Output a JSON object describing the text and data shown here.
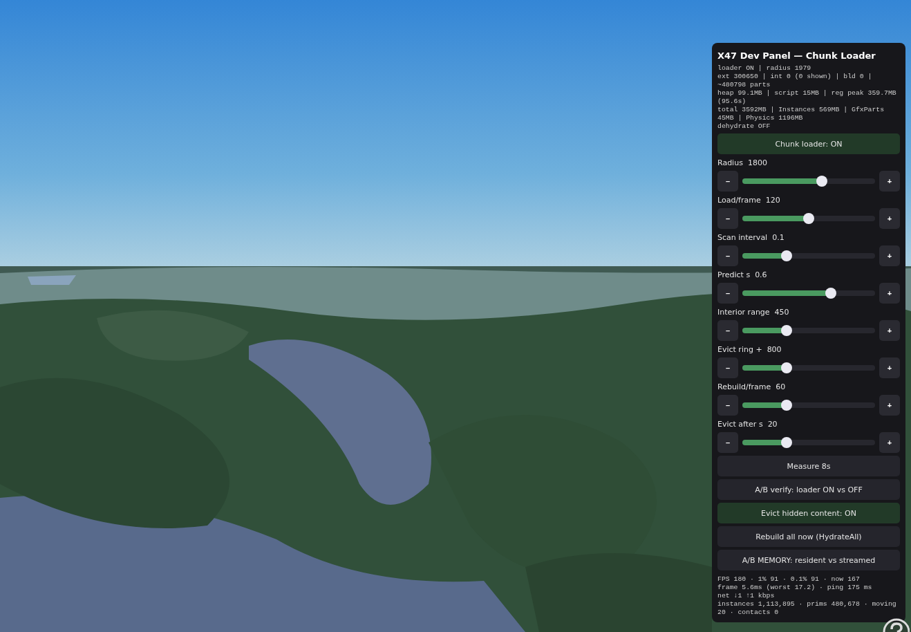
{
  "panel": {
    "title": "X47 Dev Panel — Chunk Loader",
    "status_lines": [
      "loader ON | radius 1979",
      "ext 300650 | int 0 (0 shown) | bld 0 | ~480798 parts",
      "heap 99.1MB | script 15MB | reg peak 359.7MB (95.6s)",
      "total 3592MB | Instances 569MB | GfxParts 45MB | Physics 1196MB",
      "dehydrate OFF"
    ],
    "controls": [
      {
        "kind": "toggle",
        "label": "Chunk loader: ON",
        "on": true
      },
      {
        "kind": "slider",
        "label": "Radius",
        "value": "1800",
        "level": 0.6,
        "minus": "–",
        "plus": "+"
      },
      {
        "kind": "slider",
        "label": "Load/frame",
        "value": "120",
        "level": 0.5,
        "minus": "–",
        "plus": "+"
      },
      {
        "kind": "slider",
        "label": "Scan interval",
        "value": "0.1",
        "level": 0.333,
        "minus": "–",
        "plus": "+"
      },
      {
        "kind": "slider",
        "label": "Predict s",
        "value": "0.6",
        "level": 0.667,
        "minus": "–",
        "plus": "+"
      },
      {
        "kind": "slider",
        "label": "Interior range",
        "value": "450",
        "level": 0.333,
        "minus": "–",
        "plus": "+"
      },
      {
        "kind": "slider",
        "label": "Evict ring +",
        "value": "800",
        "level": 0.333,
        "minus": "–",
        "plus": "+"
      },
      {
        "kind": "slider",
        "label": "Rebuild/frame",
        "value": "60",
        "level": 0.333,
        "minus": "–",
        "plus": "+"
      },
      {
        "kind": "slider",
        "label": "Evict after s",
        "value": "20",
        "level": 0.333,
        "minus": "–",
        "plus": "+"
      },
      {
        "kind": "action",
        "label": "Measure 8s"
      },
      {
        "kind": "action",
        "label": "A/B verify: loader ON vs OFF"
      },
      {
        "kind": "toggle",
        "label": "Evict hidden content: ON",
        "on": true
      },
      {
        "kind": "action",
        "label": "Rebuild all now (HydrateAll)"
      },
      {
        "kind": "action",
        "label": "A/B MEMORY: resident vs streamed"
      }
    ],
    "stats_lines": [
      "FPS 180 · 1% 91 · 0.1% 91 · now 167",
      "frame 5.6ms (worst 17.2) · ping 175 ms",
      "net ↓1 ↑1 kbps",
      "instances 1,113,895 · prims 480,678 · moving 20 · contacts 0"
    ]
  }
}
